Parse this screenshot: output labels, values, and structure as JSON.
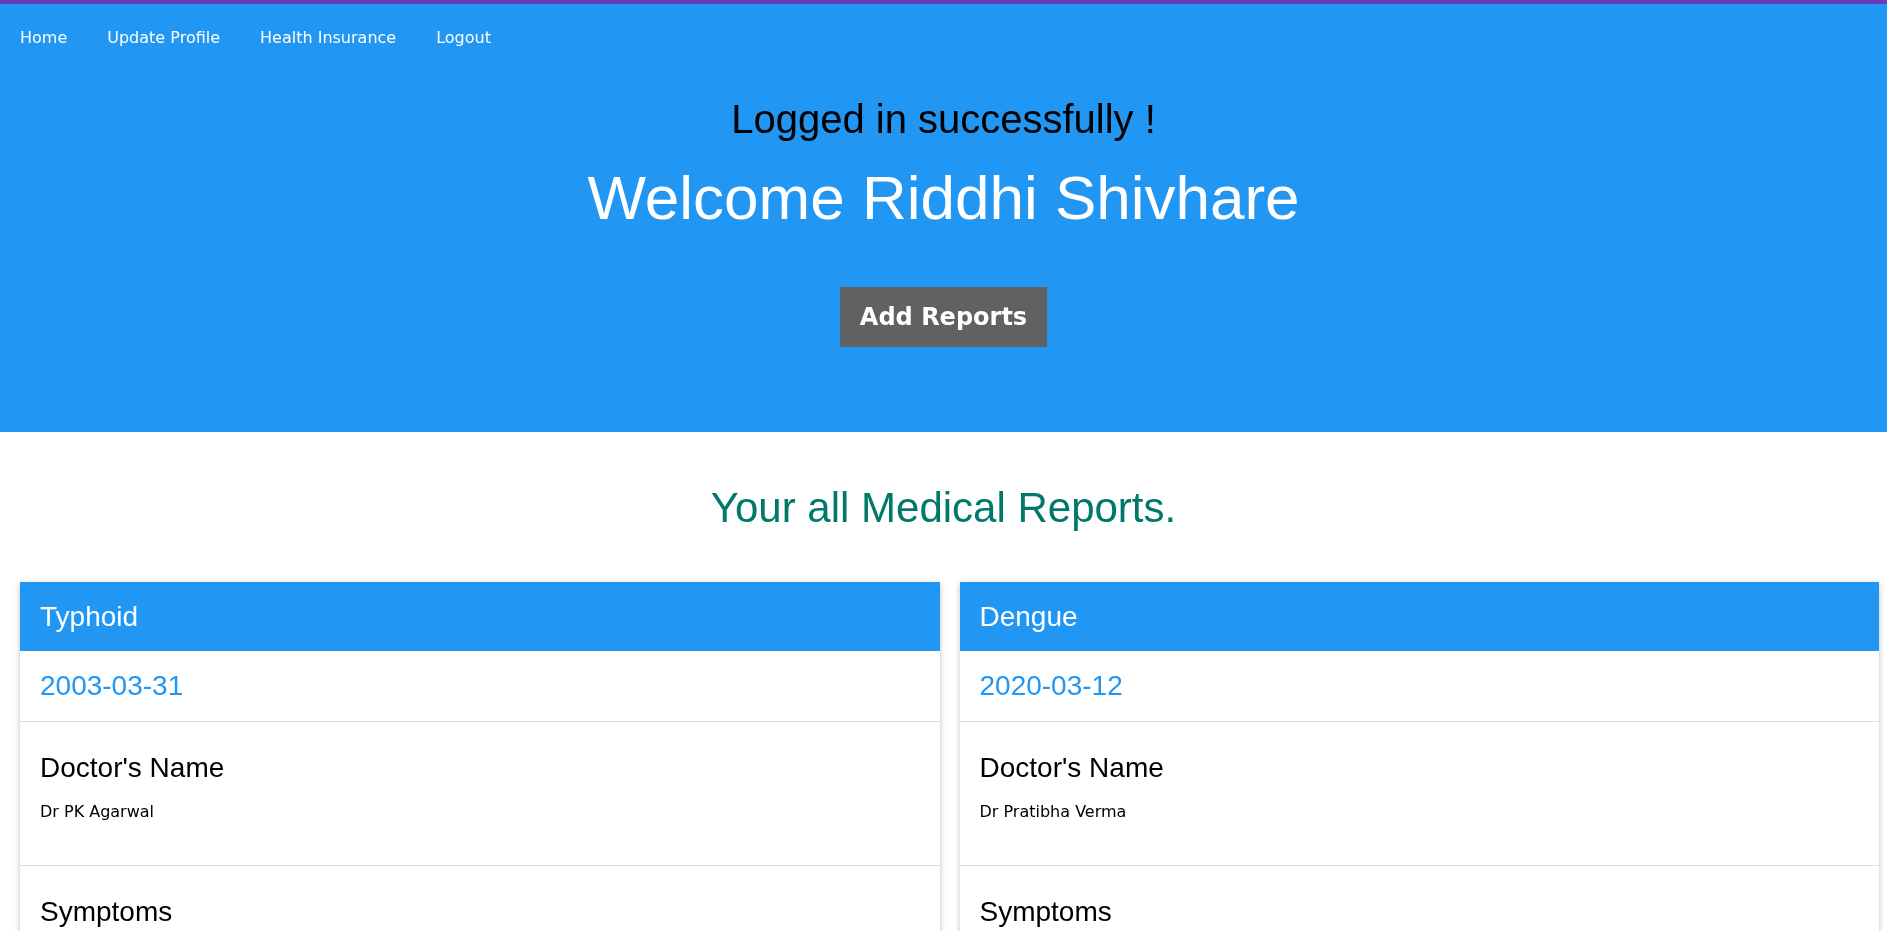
{
  "nav": [
    {
      "label": "Home"
    },
    {
      "label": "Update Profile"
    },
    {
      "label": "Health Insurance"
    },
    {
      "label": "Logout"
    }
  ],
  "header": {
    "status": "Logged in successfully !",
    "welcome": "Welcome Riddhi Shivhare",
    "button": "Add Reports"
  },
  "section_title": "Your all Medical Reports.",
  "reports": [
    {
      "disease": "Typhoid",
      "date": "2003-03-31",
      "doctor_label": "Doctor's Name",
      "doctor": "Dr PK Agarwal",
      "symptoms_label": "Symptoms"
    },
    {
      "disease": "Dengue",
      "date": "2020-03-12",
      "doctor_label": "Doctor's Name",
      "doctor": "Dr Pratibha Verma",
      "symptoms_label": "Symptoms"
    }
  ]
}
